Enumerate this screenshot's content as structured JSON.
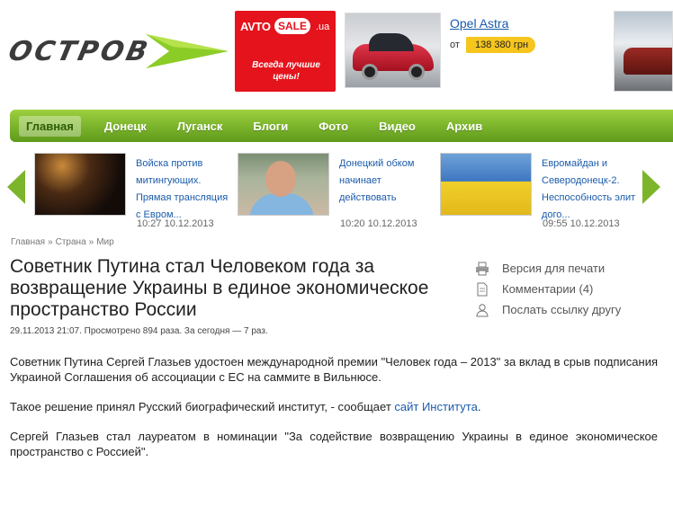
{
  "header": {
    "logo_text": "ОСТРОВ",
    "ad": {
      "brand": "AVTO",
      "sale": "SALE",
      "domain": ".ua",
      "slogan": "Всегда лучшие цены!"
    },
    "car_ad": {
      "title": "Opel Astra",
      "price_from": "от",
      "price": "138 380 грн"
    }
  },
  "nav": {
    "items": [
      {
        "label": "Главная",
        "active": true
      },
      {
        "label": "Донецк"
      },
      {
        "label": "Луганск"
      },
      {
        "label": "Блоги"
      },
      {
        "label": "Фото"
      },
      {
        "label": "Видео"
      },
      {
        "label": "Архив"
      }
    ]
  },
  "news": [
    {
      "title": "Войска против митингующих. Прямая трансляция с Евром...",
      "time": "10:27 10.12.2013"
    },
    {
      "title": "Донецкий обком начинает действовать",
      "time": "10:20 10.12.2013"
    },
    {
      "title": "Евромайдан и Северодонецк-2. Неспособность элит дого...",
      "time": "09:55 10.12.2013"
    }
  ],
  "breadcrumb": [
    "Главная",
    "Страна",
    "Мир"
  ],
  "article": {
    "title": "Советник Путина стал Человеком года за возвращение Украины в единое экономическое пространство России",
    "meta": "29.11.2013 21:07. Просмотрено 894 раза. За сегодня — 7 раз.",
    "p1": "Советник Путина Сергей Глазьев удостоен международной премии \"Человек года – 2013\" за вклад в срыв подписания Украиной Соглашения об ассоциации с ЕС на саммите в Вильнюсе.",
    "p2_text": "Такое решение принял Русский биографический институт, - сообщает ",
    "p2_link": "сайт Института",
    "p2_end": ".",
    "p3": "Сергей Глазьев стал лауреатом в номинации \"За содействие возвращению Украины в единое экономическое пространство с Россией\"."
  },
  "tools": {
    "print": "Версия для печати",
    "comments": "Комментарии (4)",
    "send": "Послать ссылку другу"
  },
  "colors": {
    "nav_green": "#7cb52c",
    "link_blue": "#1a5bab",
    "ad_red": "#e4131c",
    "price_yellow": "#f6c61e"
  }
}
